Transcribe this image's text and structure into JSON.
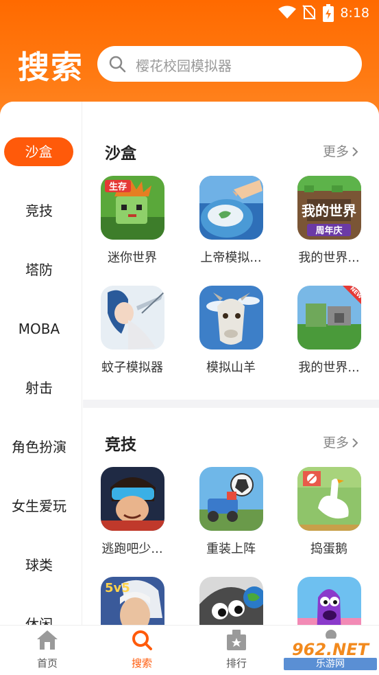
{
  "status_bar": {
    "time": "8:18"
  },
  "header": {
    "title": "搜索",
    "search_placeholder": "樱花校园模拟器"
  },
  "sidebar": {
    "items": [
      {
        "label": "沙盒",
        "active": true
      },
      {
        "label": "竞技"
      },
      {
        "label": "塔防"
      },
      {
        "label": "MOBA"
      },
      {
        "label": "射击"
      },
      {
        "label": "角色扮演"
      },
      {
        "label": "女生爱玩"
      },
      {
        "label": "球类"
      },
      {
        "label": "休闲"
      }
    ]
  },
  "sections": [
    {
      "title": "沙盒",
      "more": "更多",
      "apps": [
        {
          "name": "迷你世界",
          "icon": "mini-world-icon"
        },
        {
          "name": "上帝模拟...",
          "icon": "god-simulator-icon"
        },
        {
          "name": "我的世界...",
          "icon": "minecraft-anniversary-icon",
          "badge": "周年庆",
          "banner": "我的世界"
        },
        {
          "name": "蚊子模拟器",
          "icon": "mosquito-simulator-icon"
        },
        {
          "name": "模拟山羊",
          "icon": "goat-simulator-icon"
        },
        {
          "name": "我的世界...",
          "icon": "minecraft-new-icon",
          "ribbon": "NEW"
        }
      ]
    },
    {
      "title": "竞技",
      "more": "更多",
      "apps": [
        {
          "name": "逃跑吧少...",
          "icon": "escape-boy-icon"
        },
        {
          "name": "重装上阵",
          "icon": "heavy-armor-icon"
        },
        {
          "name": "捣蛋鹅",
          "icon": "untitled-goose-icon"
        },
        {
          "name": "",
          "icon": "5v5-hero-icon",
          "badge": "5v5"
        },
        {
          "name": "",
          "icon": "eyeball-game-icon"
        },
        {
          "name": "",
          "icon": "purple-monster-icon"
        }
      ]
    }
  ],
  "bottom_nav": [
    {
      "label": "首页",
      "icon": "home-icon"
    },
    {
      "label": "搜索",
      "icon": "search-icon",
      "active": true
    },
    {
      "label": "排行",
      "icon": "ranking-icon"
    },
    {
      "label": "",
      "icon": "profile-icon"
    }
  ],
  "watermark": {
    "number": "962.NET",
    "sub": "乐游网"
  },
  "colors": {
    "accent": "#ff5a0a",
    "header_top": "#ff6a00",
    "header_bottom": "#ff8a2a"
  }
}
